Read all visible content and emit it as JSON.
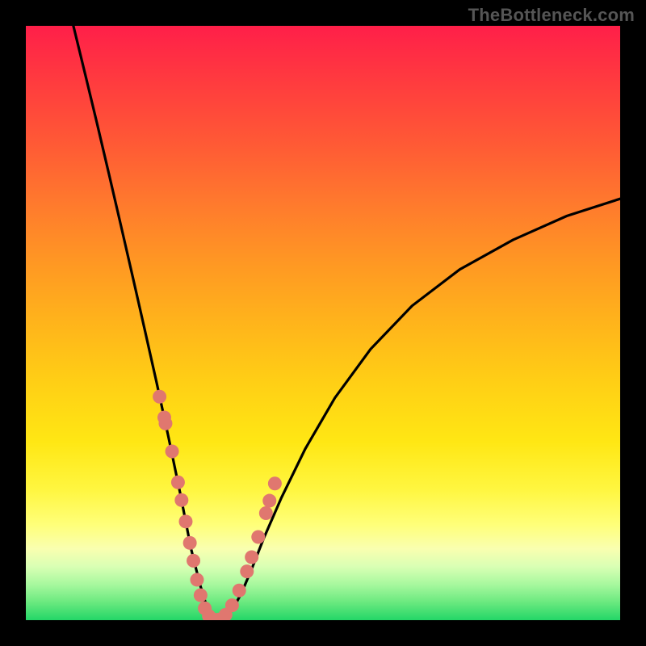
{
  "watermark": "TheBottleneck.com",
  "chart_data": {
    "type": "line",
    "title": "",
    "xlabel": "",
    "ylabel": "",
    "xlim": [
      0,
      1
    ],
    "ylim": [
      0,
      1
    ],
    "series": [
      {
        "name": "bottleneck-curve",
        "x": [
          0.08,
          0.1,
          0.12,
          0.14,
          0.16,
          0.18,
          0.2,
          0.22,
          0.24,
          0.26,
          0.278,
          0.293,
          0.304,
          0.313,
          0.323,
          0.334,
          0.348,
          0.363,
          0.38,
          0.4,
          0.43,
          0.47,
          0.52,
          0.58,
          0.65,
          0.73,
          0.82,
          0.91,
          1.0
        ],
        "y": [
          1.0,
          0.918,
          0.835,
          0.75,
          0.664,
          0.577,
          0.489,
          0.4,
          0.308,
          0.212,
          0.12,
          0.06,
          0.024,
          0.006,
          0.0,
          0.003,
          0.018,
          0.046,
          0.086,
          0.137,
          0.206,
          0.288,
          0.374,
          0.456,
          0.529,
          0.59,
          0.64,
          0.68,
          0.709
        ]
      },
      {
        "name": "marker-points",
        "x": [
          0.225,
          0.233,
          0.235,
          0.246,
          0.256,
          0.262,
          0.269,
          0.276,
          0.282,
          0.288,
          0.294,
          0.301,
          0.308,
          0.316,
          0.325,
          0.336,
          0.347,
          0.359,
          0.372,
          0.38,
          0.391,
          0.404,
          0.41,
          0.419
        ],
        "y": [
          0.376,
          0.341,
          0.331,
          0.284,
          0.232,
          0.202,
          0.166,
          0.13,
          0.1,
          0.068,
          0.042,
          0.02,
          0.007,
          0.001,
          0.001,
          0.009,
          0.025,
          0.05,
          0.082,
          0.106,
          0.14,
          0.18,
          0.201,
          0.23
        ]
      }
    ],
    "marker_color": "#e0776f",
    "curve_color": "#000000",
    "gradient_stops": [
      {
        "pos": 0.0,
        "color": "#ff1f49"
      },
      {
        "pos": 0.5,
        "color": "#ffb41b"
      },
      {
        "pos": 0.84,
        "color": "#ffff7a"
      },
      {
        "pos": 1.0,
        "color": "#23d667"
      }
    ]
  }
}
